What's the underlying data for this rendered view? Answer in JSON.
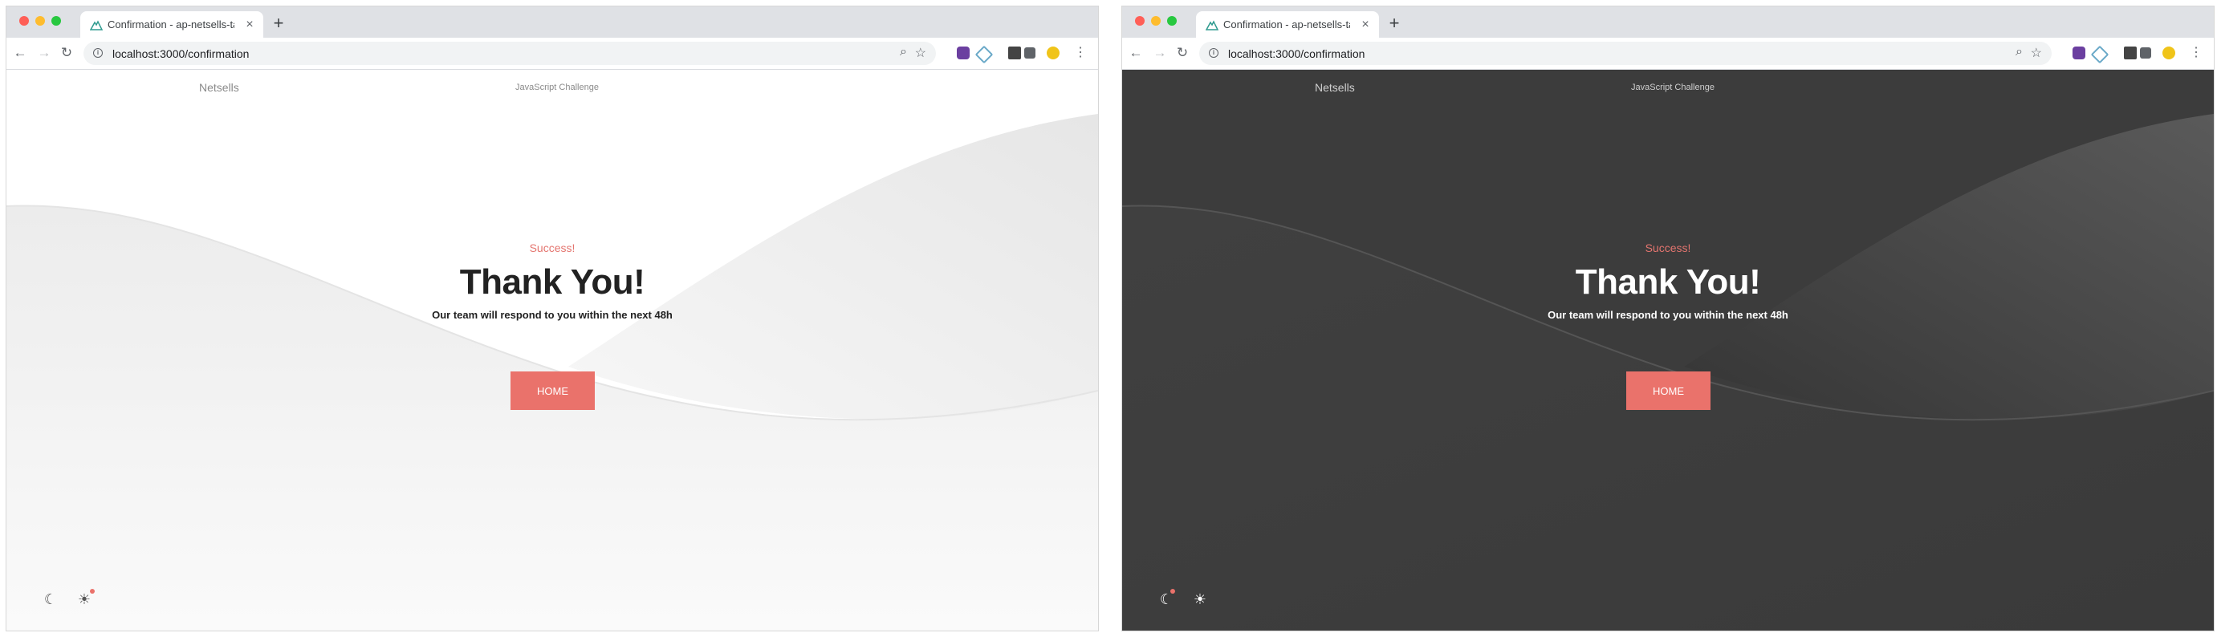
{
  "browser": {
    "tab_title": "Confirmation - ap-netsells-task",
    "tab_close": "×",
    "new_tab": "+",
    "url": "localhost:3000/confirmation",
    "back": "←",
    "forward": "→",
    "reload": "↻",
    "info": "i",
    "zoom": "⌕",
    "star": "☆",
    "menu": "⋮"
  },
  "site": {
    "brand": "Netsells",
    "nav_link": "JavaScript Challenge"
  },
  "confirmation": {
    "label": "Success!",
    "heading": "Thank You!",
    "message": "Our team will respond to you within the next 48h",
    "home_button": "HOME"
  },
  "theme_toggle": {
    "moon": "☾",
    "sun": "☀"
  },
  "themes": {
    "light": {
      "accent": "#ea726b",
      "background": "#ffffff",
      "active": "sun"
    },
    "dark": {
      "accent": "#ea726b",
      "background": "#3c3c3c",
      "active": "moon"
    }
  }
}
